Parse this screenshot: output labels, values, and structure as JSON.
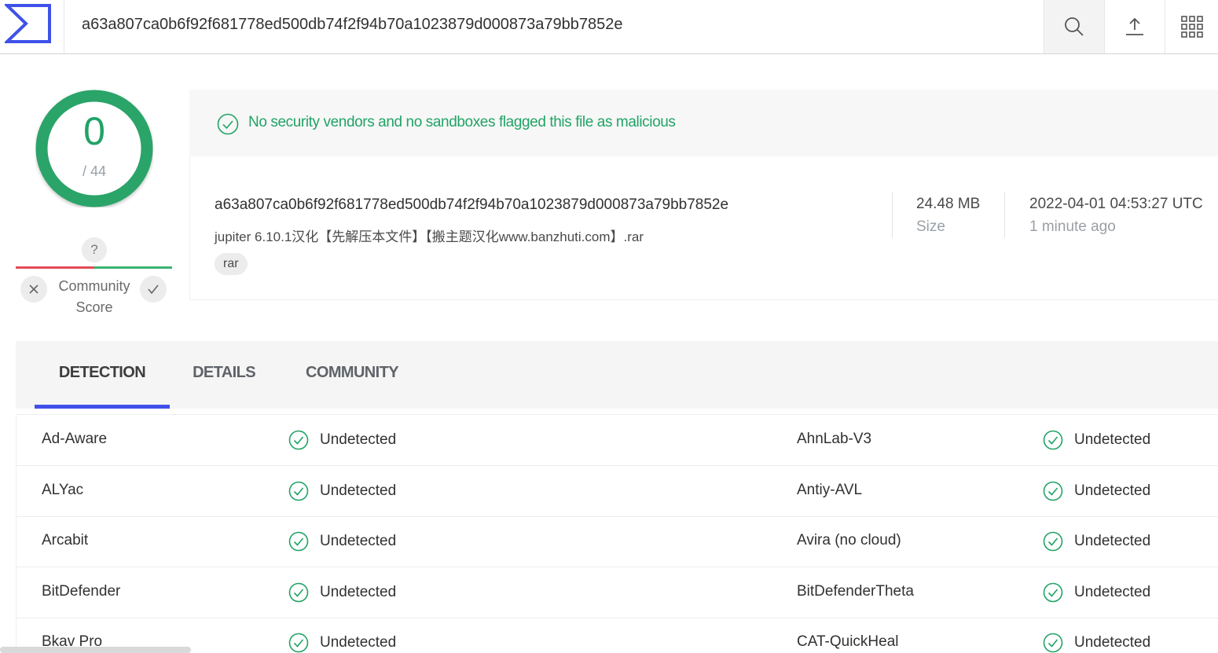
{
  "header": {
    "logo": "virustotal-logo",
    "search_value": "a63a807ca0b6f92f681778ed500db74f2f94b70a1023879d000873a79bb7852e",
    "icons": [
      "search-icon",
      "upload-icon",
      "apps-grid-icon"
    ]
  },
  "score": {
    "detections": "0",
    "total": "/ 44",
    "ring_color": "#21a366"
  },
  "community_score": {
    "value": "?",
    "label_line1": "Community",
    "label_line2": "Score"
  },
  "banner": {
    "message": "No security vendors and no sandboxes flagged this file as malicious",
    "color": "#21a366"
  },
  "file": {
    "hash": "a63a807ca0b6f92f681778ed500db74f2f94b70a1023879d000873a79bb7852e",
    "name": "jupiter 6.10.1汉化【先解压本文件】【搬主题汉化www.banzhuti.com】.rar",
    "tag": "rar",
    "size_value": "24.48 MB",
    "size_label": "Size",
    "date_value": "2022-04-01 04:53:27 UTC",
    "date_label": "1 minute ago"
  },
  "tabs": [
    {
      "label": "DETECTION",
      "active": true
    },
    {
      "label": "DETAILS",
      "active": false
    },
    {
      "label": "COMMUNITY",
      "active": false
    }
  ],
  "accent_color": "#3f51e8",
  "detections": [
    {
      "left_vendor": "Ad-Aware",
      "left_result": "Undetected",
      "right_vendor": "AhnLab-V3",
      "right_result": "Undetected"
    },
    {
      "left_vendor": "ALYac",
      "left_result": "Undetected",
      "right_vendor": "Antiy-AVL",
      "right_result": "Undetected"
    },
    {
      "left_vendor": "Arcabit",
      "left_result": "Undetected",
      "right_vendor": "Avira (no cloud)",
      "right_result": "Undetected"
    },
    {
      "left_vendor": "BitDefender",
      "left_result": "Undetected",
      "right_vendor": "BitDefenderTheta",
      "right_result": "Undetected"
    },
    {
      "left_vendor": "Bkav Pro",
      "left_result": "Undetected",
      "right_vendor": "CAT-QuickHeal",
      "right_result": "Undetected"
    }
  ]
}
